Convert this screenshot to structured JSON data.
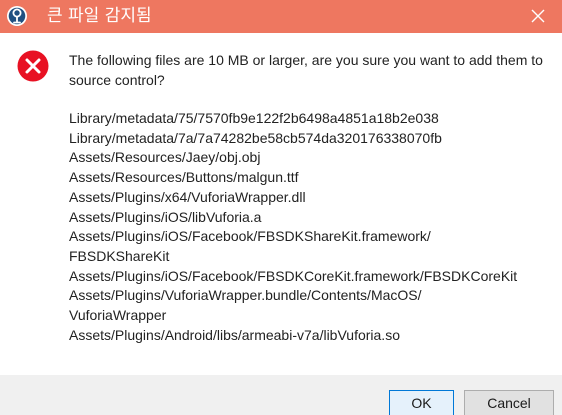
{
  "window": {
    "title": "큰 파일 감지됨",
    "app_icon": "sourcetree-icon",
    "close_icon": "close-icon",
    "titlebar_color": "#ee7760"
  },
  "message": {
    "icon": "error-icon",
    "icon_color": "#e81123",
    "text": "The following files are 10 MB or larger, are you sure you want to add them to source control?"
  },
  "files": [
    "Library/metadata/75/7570fb9e122f2b6498a4851a18b2e038",
    "Library/metadata/7a/7a74282be58cb574da320176338070fb",
    "Assets/Resources/Jaey/obj.obj",
    "Assets/Resources/Buttons/malgun.ttf",
    "Assets/Plugins/x64/VuforiaWrapper.dll",
    "Assets/Plugins/iOS/libVuforia.a",
    "Assets/Plugins/iOS/Facebook/FBSDKShareKit.framework/",
    "FBSDKShareKit",
    "Assets/Plugins/iOS/Facebook/FBSDKCoreKit.framework/FBSDKCoreKit",
    "Assets/Plugins/VuforiaWrapper.bundle/Contents/MacOS/",
    "VuforiaWrapper",
    "Assets/Plugins/Android/libs/armeabi-v7a/libVuforia.so"
  ],
  "buttons": {
    "ok": "OK",
    "cancel": "Cancel"
  }
}
